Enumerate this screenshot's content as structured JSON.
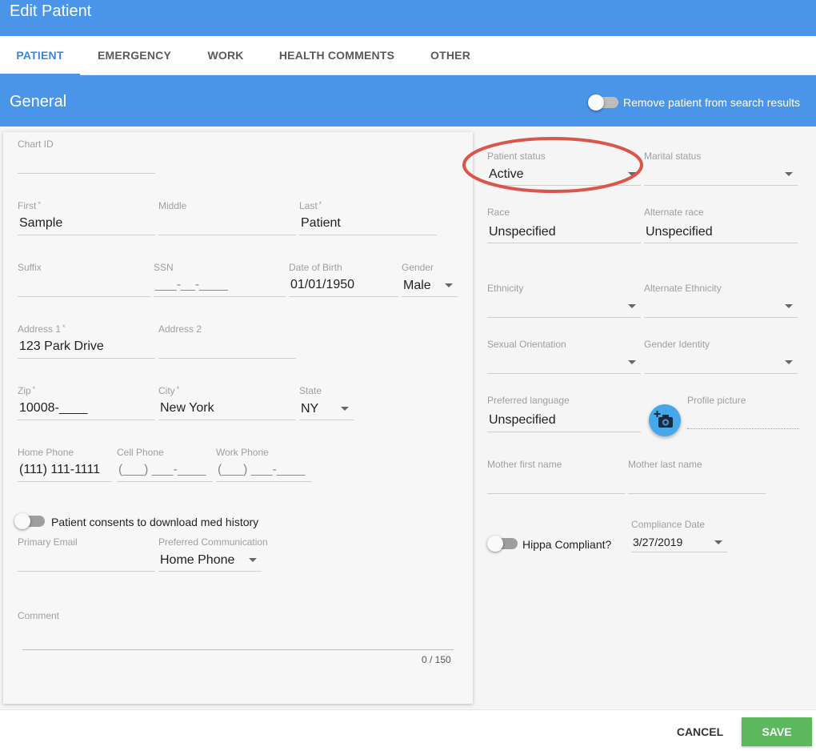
{
  "window": {
    "title": "Edit Patient"
  },
  "tabs": [
    {
      "label": "PATIENT",
      "active": true
    },
    {
      "label": "EMERGENCY",
      "active": false
    },
    {
      "label": "WORK",
      "active": false
    },
    {
      "label": "HEALTH COMMENTS",
      "active": false
    },
    {
      "label": "OTHER",
      "active": false
    }
  ],
  "section": {
    "title": "General",
    "remove_toggle_label": "Remove patient from search results"
  },
  "form": {
    "chart_id": {
      "label": "Chart ID",
      "value": ""
    },
    "first": {
      "label": "First",
      "required": "*",
      "value": "Sample"
    },
    "middle": {
      "label": "Middle",
      "value": ""
    },
    "last": {
      "label": "Last",
      "required": "*",
      "value": "Patient"
    },
    "suffix": {
      "label": "Suffix",
      "value": ""
    },
    "ssn": {
      "label": "SSN",
      "placeholder": "___-__-____"
    },
    "dob": {
      "label": "Date of Birth",
      "value": "01/01/1950"
    },
    "gender": {
      "label": "Gender",
      "value": "Male"
    },
    "address1": {
      "label": "Address 1",
      "required": "*",
      "value": "123 Park Drive"
    },
    "address2": {
      "label": "Address 2",
      "value": ""
    },
    "zip": {
      "label": "Zip",
      "required": "*",
      "value": "10008-____"
    },
    "city": {
      "label": "City",
      "required": "*",
      "value": "New York"
    },
    "state": {
      "label": "State",
      "value": "NY"
    },
    "home_phone": {
      "label": "Home Phone",
      "value": "(111) 111-1111"
    },
    "cell_phone": {
      "label": "Cell Phone",
      "placeholder": "(___) ___-____"
    },
    "work_phone": {
      "label": "Work Phone",
      "placeholder": "(___) ___-____"
    },
    "consent_toggle_label": "Patient consents to download med history",
    "primary_email": {
      "label": "Primary Email",
      "value": ""
    },
    "preferred_communication": {
      "label": "Preferred Communication",
      "value": "Home Phone"
    },
    "comment": {
      "label": "Comment",
      "value": "",
      "counter": "0 / 150"
    }
  },
  "right": {
    "patient_status": {
      "label": "Patient status",
      "value": "Active"
    },
    "marital_status": {
      "label": "Marital status",
      "value": ""
    },
    "race": {
      "label": "Race",
      "value": "Unspecified"
    },
    "alternate_race": {
      "label": "Alternate race",
      "value": "Unspecified"
    },
    "ethnicity": {
      "label": "Ethnicity",
      "value": ""
    },
    "alternate_ethnicity": {
      "label": "Alternate Ethnicity",
      "value": ""
    },
    "sexual_orientation": {
      "label": "Sexual Orientation",
      "value": ""
    },
    "gender_identity": {
      "label": "Gender Identity",
      "value": ""
    },
    "preferred_language": {
      "label": "Preferred language",
      "value": "Unspecified"
    },
    "profile_picture": {
      "label": "Profile picture"
    },
    "mother_first": {
      "label": "Mother first name",
      "value": ""
    },
    "mother_last": {
      "label": "Mother last name",
      "value": ""
    },
    "hippa_toggle_label": "Hippa Compliant?",
    "compliance_date": {
      "label": "Compliance Date",
      "value": "3/27/2019"
    }
  },
  "footer": {
    "cancel_label": "CANCEL",
    "save_label": "SAVE"
  },
  "colors": {
    "header": "#4a95e8",
    "save": "#5cb85c",
    "annotation": "#d9574a",
    "camera": "#46a7ea"
  },
  "icons": {
    "camera": "add-photo-icon",
    "dropdown": "caret-down-icon"
  }
}
